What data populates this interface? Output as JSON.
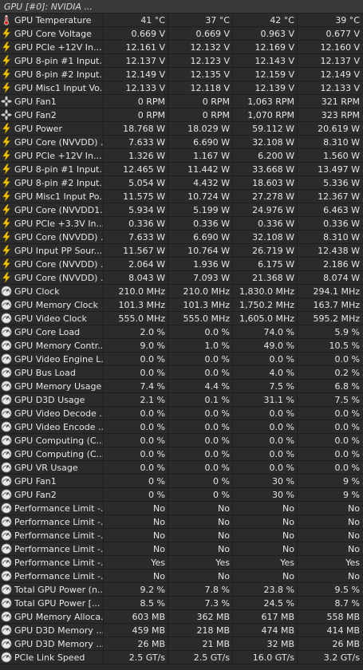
{
  "header": {
    "title": "GPU [#0]: NVIDIA ..."
  },
  "rows": [
    {
      "icon": "thermometer-icon",
      "label": "GPU Temperature",
      "values": [
        "41 °C",
        "37 °C",
        "42 °C",
        "39 °C"
      ]
    },
    {
      "icon": "lightning-icon",
      "label": "GPU Core Voltage",
      "values": [
        "0.669 V",
        "0.669 V",
        "0.963 V",
        "0.677 V"
      ]
    },
    {
      "icon": "lightning-icon",
      "label": "GPU PCIe +12V In...",
      "values": [
        "12.161 V",
        "12.132 V",
        "12.169 V",
        "12.160 V"
      ]
    },
    {
      "icon": "lightning-icon",
      "label": "GPU 8-pin #1 Input...",
      "values": [
        "12.137 V",
        "12.123 V",
        "12.143 V",
        "12.137 V"
      ]
    },
    {
      "icon": "lightning-icon",
      "label": "GPU 8-pin #2 Input...",
      "values": [
        "12.149 V",
        "12.135 V",
        "12.159 V",
        "12.149 V"
      ]
    },
    {
      "icon": "lightning-icon",
      "label": "GPU Misc1 Input Vo...",
      "values": [
        "12.133 V",
        "12.118 V",
        "12.139 V",
        "12.133 V"
      ]
    },
    {
      "icon": "fan-icon",
      "label": "GPU Fan1",
      "values": [
        "0 RPM",
        "0 RPM",
        "1,063 RPM",
        "321 RPM"
      ]
    },
    {
      "icon": "fan-icon",
      "label": "GPU Fan2",
      "values": [
        "0 RPM",
        "0 RPM",
        "1,070 RPM",
        "323 RPM"
      ]
    },
    {
      "icon": "lightning-icon",
      "label": "GPU Power",
      "values": [
        "18.768 W",
        "18.029 W",
        "59.112 W",
        "20.619 W"
      ]
    },
    {
      "icon": "lightning-icon",
      "label": "GPU Core (NVVDD) ...",
      "values": [
        "7.633 W",
        "6.690 W",
        "32.108 W",
        "8.310 W"
      ]
    },
    {
      "icon": "lightning-icon",
      "label": "GPU PCIe +12V In...",
      "values": [
        "1.326 W",
        "1.167 W",
        "6.200 W",
        "1.560 W"
      ]
    },
    {
      "icon": "lightning-icon",
      "label": "GPU 8-pin #1 Input...",
      "values": [
        "12.465 W",
        "11.442 W",
        "33.668 W",
        "13.497 W"
      ]
    },
    {
      "icon": "lightning-icon",
      "label": "GPU 8-pin #2 Input...",
      "values": [
        "5.054 W",
        "4.432 W",
        "18.603 W",
        "5.336 W"
      ]
    },
    {
      "icon": "lightning-icon",
      "label": "GPU Misc1 Input Po...",
      "values": [
        "11.575 W",
        "10.724 W",
        "27.278 W",
        "12.367 W"
      ]
    },
    {
      "icon": "lightning-icon",
      "label": "GPU Core (NVVDD1...",
      "values": [
        "5.934 W",
        "5.199 W",
        "24.976 W",
        "6.463 W"
      ]
    },
    {
      "icon": "lightning-icon",
      "label": "GPU PCIe +3.3V In...",
      "values": [
        "0.336 W",
        "0.336 W",
        "0.336 W",
        "0.336 W"
      ]
    },
    {
      "icon": "lightning-icon",
      "label": "GPU Core (NVVDD) ...",
      "values": [
        "7.633 W",
        "6.690 W",
        "32.108 W",
        "8.310 W"
      ]
    },
    {
      "icon": "lightning-icon",
      "label": "GPU Input PP Sour...",
      "values": [
        "11.567 W",
        "10.764 W",
        "26.719 W",
        "12.438 W"
      ]
    },
    {
      "icon": "lightning-icon",
      "label": "GPU Core (NVVDD) ...",
      "values": [
        "2.064 W",
        "1.936 W",
        "6.175 W",
        "2.186 W"
      ]
    },
    {
      "icon": "lightning-icon",
      "label": "GPU Core (NVVDD) ...",
      "values": [
        "8.043 W",
        "7.093 W",
        "21.368 W",
        "8.074 W"
      ]
    },
    {
      "icon": "gauge-icon",
      "label": "GPU Clock",
      "values": [
        "210.0 MHz",
        "210.0 MHz",
        "1,830.0 MHz",
        "294.1 MHz"
      ]
    },
    {
      "icon": "gauge-icon",
      "label": "GPU Memory Clock",
      "values": [
        "101.3 MHz",
        "101.3 MHz",
        "1,750.2 MHz",
        "163.7 MHz"
      ]
    },
    {
      "icon": "gauge-icon",
      "label": "GPU Video Clock",
      "values": [
        "555.0 MHz",
        "555.0 MHz",
        "1,605.0 MHz",
        "595.2 MHz"
      ]
    },
    {
      "icon": "gauge-icon",
      "label": "GPU Core Load",
      "values": [
        "2.0 %",
        "0.0 %",
        "74.0 %",
        "5.9 %"
      ]
    },
    {
      "icon": "gauge-icon",
      "label": "GPU Memory Contr...",
      "values": [
        "9.0 %",
        "1.0 %",
        "49.0 %",
        "10.5 %"
      ]
    },
    {
      "icon": "gauge-icon",
      "label": "GPU Video Engine L...",
      "values": [
        "0.0 %",
        "0.0 %",
        "0.0 %",
        "0.0 %"
      ]
    },
    {
      "icon": "gauge-icon",
      "label": "GPU Bus Load",
      "values": [
        "0.0 %",
        "0.0 %",
        "4.0 %",
        "0.2 %"
      ]
    },
    {
      "icon": "gauge-icon",
      "label": "GPU Memory Usage",
      "values": [
        "7.4 %",
        "4.4 %",
        "7.5 %",
        "6.8 %"
      ]
    },
    {
      "icon": "gauge-icon",
      "label": "GPU D3D Usage",
      "values": [
        "2.1 %",
        "0.1 %",
        "31.1 %",
        "7.5 %"
      ]
    },
    {
      "icon": "gauge-icon",
      "label": "GPU Video Decode ...",
      "values": [
        "0.0 %",
        "0.0 %",
        "0.0 %",
        "0.0 %"
      ]
    },
    {
      "icon": "gauge-icon",
      "label": "GPU Video Encode ...",
      "values": [
        "0.0 %",
        "0.0 %",
        "0.0 %",
        "0.0 %"
      ]
    },
    {
      "icon": "gauge-icon",
      "label": "GPU Computing (C...",
      "values": [
        "0.0 %",
        "0.0 %",
        "0.0 %",
        "0.0 %"
      ]
    },
    {
      "icon": "gauge-icon",
      "label": "GPU Computing (C...",
      "values": [
        "0.0 %",
        "0.0 %",
        "0.0 %",
        "0.0 %"
      ]
    },
    {
      "icon": "gauge-icon",
      "label": "GPU VR Usage",
      "values": [
        "0.0 %",
        "0.0 %",
        "0.0 %",
        "0.0 %"
      ]
    },
    {
      "icon": "gauge-icon",
      "label": "GPU Fan1",
      "values": [
        "0 %",
        "0 %",
        "30 %",
        "9 %"
      ]
    },
    {
      "icon": "gauge-icon",
      "label": "GPU Fan2",
      "values": [
        "0 %",
        "0 %",
        "30 %",
        "9 %"
      ]
    },
    {
      "icon": "gauge-icon",
      "label": "Performance Limit -...",
      "values": [
        "No",
        "No",
        "No",
        "No"
      ]
    },
    {
      "icon": "gauge-icon",
      "label": "Performance Limit -...",
      "values": [
        "No",
        "No",
        "No",
        "No"
      ]
    },
    {
      "icon": "gauge-icon",
      "label": "Performance Limit -...",
      "values": [
        "No",
        "No",
        "No",
        "No"
      ]
    },
    {
      "icon": "gauge-icon",
      "label": "Performance Limit -...",
      "values": [
        "No",
        "No",
        "No",
        "No"
      ]
    },
    {
      "icon": "gauge-icon",
      "label": "Performance Limit -...",
      "values": [
        "Yes",
        "Yes",
        "Yes",
        "Yes"
      ]
    },
    {
      "icon": "gauge-icon",
      "label": "Performance Limit -...",
      "values": [
        "No",
        "No",
        "No",
        "No"
      ]
    },
    {
      "icon": "gauge-icon",
      "label": "Total GPU Power (n...",
      "values": [
        "9.2 %",
        "7.8 %",
        "23.8 %",
        "9.5 %"
      ]
    },
    {
      "icon": "gauge-icon",
      "label": "Total GPU Power [...",
      "values": [
        "8.5 %",
        "7.3 %",
        "24.5 %",
        "8.7 %"
      ]
    },
    {
      "icon": "gauge-icon",
      "label": "GPU Memory Alloca...",
      "values": [
        "603 MB",
        "362 MB",
        "617 MB",
        "558 MB"
      ]
    },
    {
      "icon": "gauge-icon",
      "label": "GPU D3D Memory ...",
      "values": [
        "459 MB",
        "218 MB",
        "474 MB",
        "414 MB"
      ]
    },
    {
      "icon": "gauge-icon",
      "label": "GPU D3D Memory ...",
      "values": [
        "26 MB",
        "21 MB",
        "32 MB",
        "26 MB"
      ]
    },
    {
      "icon": "gauge-icon",
      "label": "PCIe Link Speed",
      "values": [
        "2.5 GT/s",
        "2.5 GT/s",
        "16.0 GT/s",
        "3.2 GT/s"
      ]
    }
  ]
}
